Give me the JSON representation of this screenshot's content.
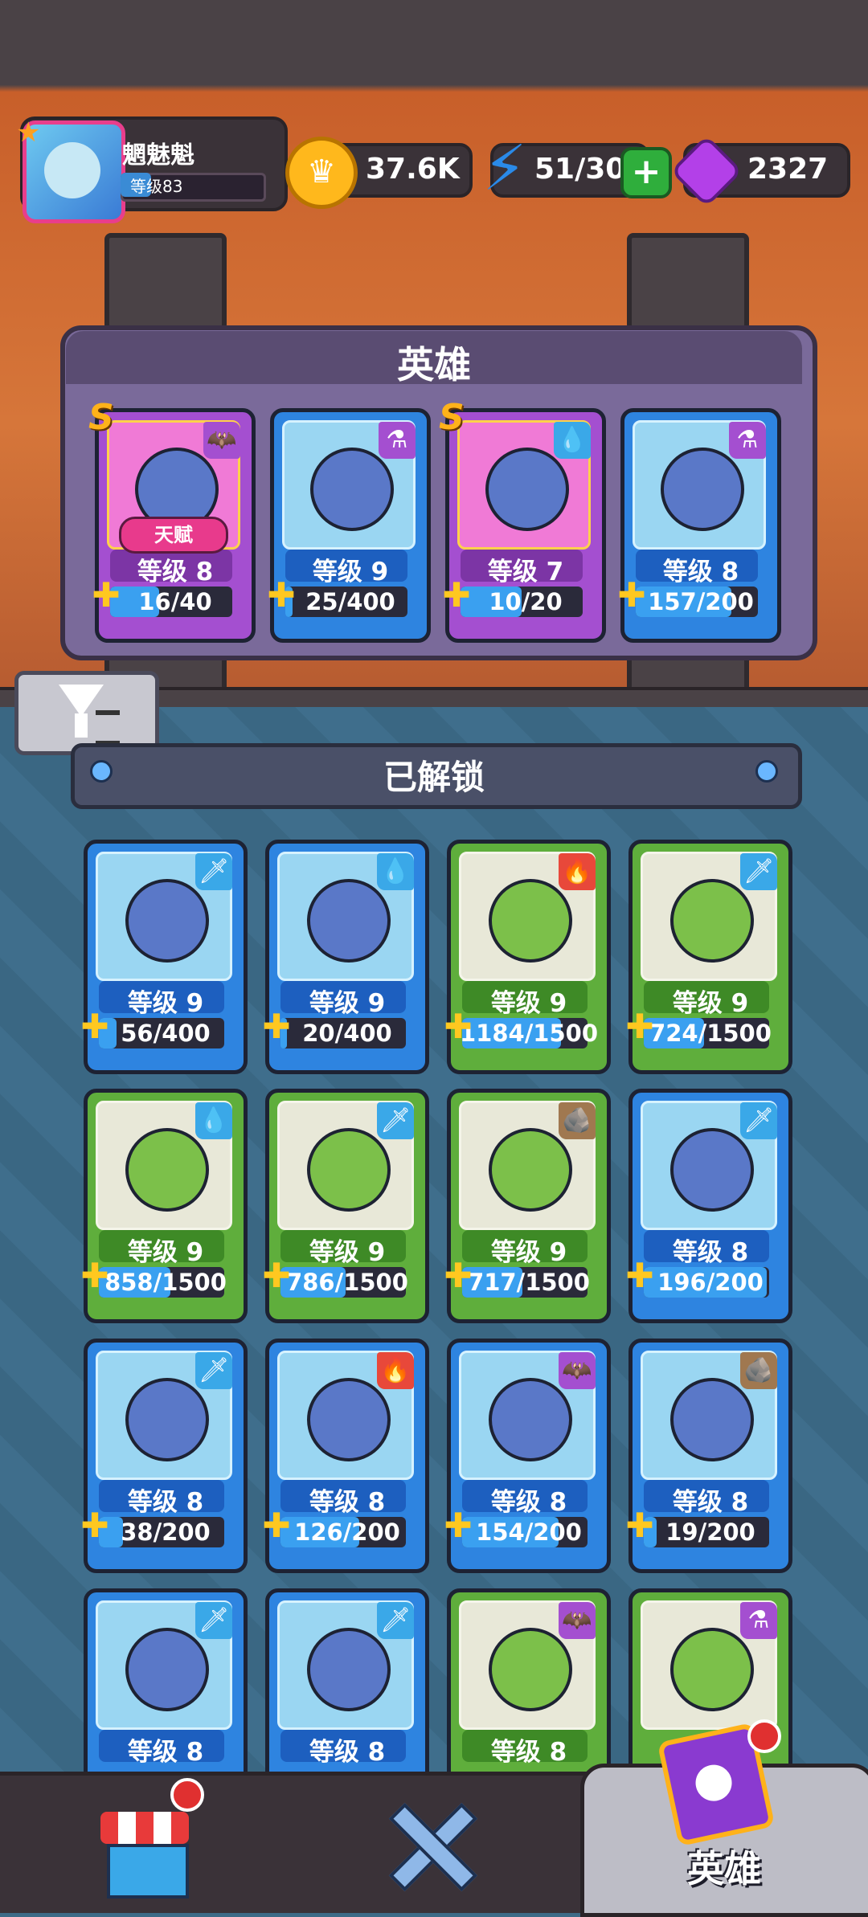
{
  "player": {
    "name": "魍魅魁",
    "level": "等级83"
  },
  "resources": {
    "gold": "37.6K",
    "energy": "51/30",
    "gems": "2327"
  },
  "hero_panel": {
    "title": "英雄",
    "talent_label": "天赋",
    "heroes": [
      {
        "level": "等级 8",
        "progress": "16/40",
        "rarity": "S",
        "element": "bat-icon",
        "color": "purple",
        "fill": 0.4
      },
      {
        "level": "等级 9",
        "progress": "25/400",
        "rarity": "",
        "element": "potion-icon",
        "color": "blue",
        "fill": 0.06
      },
      {
        "level": "等级 7",
        "progress": "10/20",
        "rarity": "S",
        "element": "water-drop-icon",
        "color": "purple",
        "fill": 0.5
      },
      {
        "level": "等级 8",
        "progress": "157/200",
        "rarity": "",
        "element": "potion-icon",
        "color": "blue",
        "fill": 0.78
      }
    ]
  },
  "unlocked": {
    "title": "已解锁",
    "heroes": [
      {
        "level": "等级 9",
        "progress": "56/400",
        "element": "sword-icon",
        "color": "blue",
        "fill": 0.14
      },
      {
        "level": "等级 9",
        "progress": "20/400",
        "element": "water-drop-icon",
        "color": "blue",
        "fill": 0.05
      },
      {
        "level": "等级 9",
        "progress": "1184/1500",
        "element": "fire-icon",
        "color": "green",
        "fill": 0.79
      },
      {
        "level": "等级 9",
        "progress": "724/1500",
        "element": "sword-icon",
        "color": "green",
        "fill": 0.48
      },
      {
        "level": "等级 9",
        "progress": "858/1500",
        "element": "water-drop-icon",
        "color": "green",
        "fill": 0.57
      },
      {
        "level": "等级 9",
        "progress": "786/1500",
        "element": "sword-icon",
        "color": "green",
        "fill": 0.52
      },
      {
        "level": "等级 9",
        "progress": "717/1500",
        "element": "rock-icon",
        "color": "green",
        "fill": 0.48
      },
      {
        "level": "等级 8",
        "progress": "196/200",
        "element": "sword-icon",
        "color": "blue",
        "fill": 0.98
      },
      {
        "level": "等级 8",
        "progress": "38/200",
        "element": "sword-icon",
        "color": "blue",
        "fill": 0.19
      },
      {
        "level": "等级 8",
        "progress": "126/200",
        "element": "fire-icon",
        "color": "blue",
        "fill": 0.63
      },
      {
        "level": "等级 8",
        "progress": "154/200",
        "element": "bat-icon",
        "color": "blue",
        "fill": 0.77
      },
      {
        "level": "等级 8",
        "progress": "19/200",
        "element": "rock-icon",
        "color": "blue",
        "fill": 0.1
      },
      {
        "level": "等级 8",
        "progress": "",
        "element": "sword-icon",
        "color": "blue",
        "fill": 0
      },
      {
        "level": "等级 8",
        "progress": "",
        "element": "sword-icon",
        "color": "blue",
        "fill": 0
      },
      {
        "level": "等级 8",
        "progress": "",
        "element": "bat-icon",
        "color": "green",
        "fill": 0
      },
      {
        "level": "",
        "progress": "",
        "element": "potion-icon",
        "color": "green",
        "fill": 0
      }
    ]
  },
  "nav": {
    "hero_tab_label": "英雄",
    "items": [
      "shop-icon",
      "battle-icon",
      "hero-cards-icon"
    ]
  }
}
